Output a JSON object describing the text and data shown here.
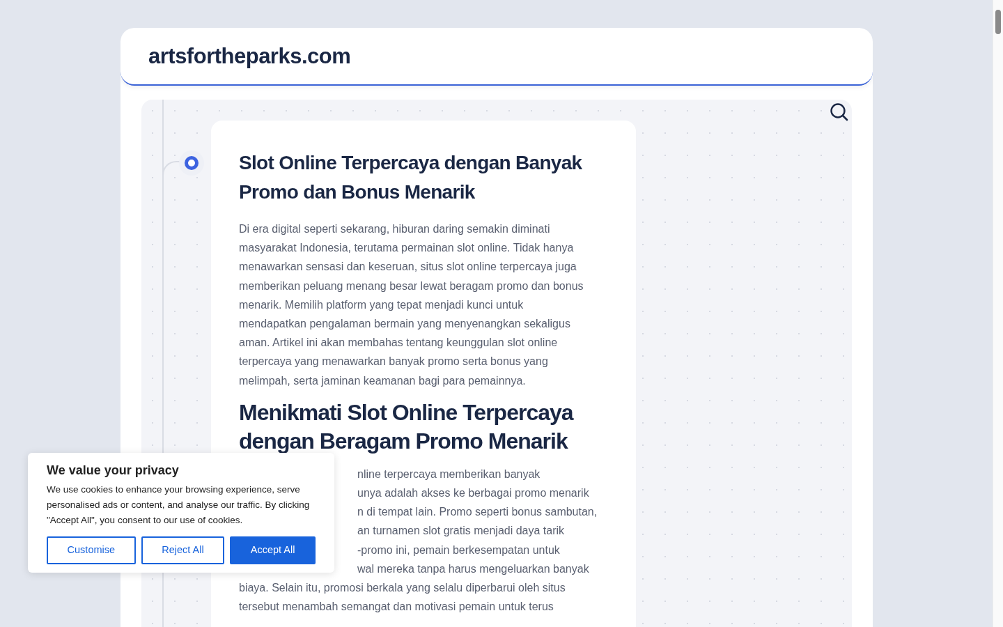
{
  "site": {
    "title": "artsfortheparks.com"
  },
  "article": {
    "title": "Slot Online Terpercaya dengan Banyak Promo dan Bonus Menarik",
    "intro": "Di era digital seperti sekarang, hiburan daring semakin diminati masyarakat Indonesia, terutama permainan slot online. Tidak hanya menawarkan sensasi dan keseruan, situs slot online terpercaya juga memberikan peluang menang besar lewat beragam promo dan bonus menarik. Memilih platform yang tepat menjadi kunci untuk mendapatkan pengalaman bermain yang menyenangkan sekaligus aman. Artikel ini akan membahas tentang keunggulan slot online terpercaya yang menawarkan banyak promo serta bonus yang melimpah, serta jaminan keamanan bagi para pemainnya.",
    "subheading": "Menikmati Slot Online Terpercaya dengan Beragam Promo Menarik",
    "lines": [
      {
        "text": "nline terpercaya memberikan banyak",
        "covered": true
      },
      {
        "text": "unya adalah akses ke berbagai promo menarik",
        "covered": true
      },
      {
        "text": "n di tempat lain. Promo seperti bonus sambutan,",
        "covered": true
      },
      {
        "text": "an turnamen slot gratis menjadi daya tarik",
        "covered": true
      },
      {
        "text": "-promo ini, pemain berkesempatan untuk",
        "covered": true
      },
      {
        "text": "wal mereka tanpa harus mengeluarkan banyak",
        "covered": true
      },
      {
        "text": "biaya. Selain itu, promosi berkala yang selalu diperbarui oleh situs",
        "covered": false
      },
      {
        "text": "tersebut menambah semangat dan motivasi pemain untuk terus",
        "covered": false
      }
    ]
  },
  "cookie_banner": {
    "title": "We value your privacy",
    "text": "We use cookies to enhance your browsing experience, serve personalised ads or content, and analyse our traffic. By clicking \"Accept All\", you consent to our use of cookies.",
    "buttons": [
      {
        "label": "Customise",
        "kind": "outline"
      },
      {
        "label": "Reject All",
        "kind": "outline"
      },
      {
        "label": "Accept All",
        "kind": "primary"
      }
    ]
  }
}
